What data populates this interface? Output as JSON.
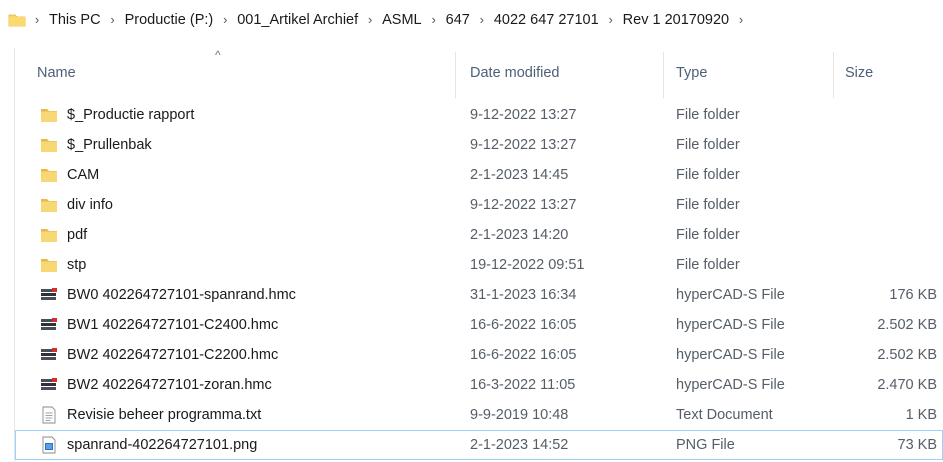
{
  "address_bar": {
    "crumbs": [
      "This PC",
      "Productie (P:)",
      "001_Artikel Archief",
      "ASML",
      "647",
      "4022 647 27101",
      "Rev 1 20170920"
    ]
  },
  "columns": {
    "name": "Name",
    "date": "Date modified",
    "type": "Type",
    "size": "Size"
  },
  "files": [
    {
      "name": "$_Productie rapport",
      "date": "9-12-2022 13:27",
      "type": "File folder",
      "size": "",
      "icon": "folder-icon"
    },
    {
      "name": "$_Prullenbak",
      "date": "9-12-2022 13:27",
      "type": "File folder",
      "size": "",
      "icon": "folder-icon"
    },
    {
      "name": "CAM",
      "date": "2-1-2023 14:45",
      "type": "File folder",
      "size": "",
      "icon": "folder-icon"
    },
    {
      "name": "div info",
      "date": "9-12-2022 13:27",
      "type": "File folder",
      "size": "",
      "icon": "folder-icon"
    },
    {
      "name": "pdf",
      "date": "2-1-2023 14:20",
      "type": "File folder",
      "size": "",
      "icon": "folder-icon"
    },
    {
      "name": "stp",
      "date": "19-12-2022 09:51",
      "type": "File folder",
      "size": "",
      "icon": "folder-icon"
    },
    {
      "name": "BW0 402264727101-spanrand.hmc",
      "date": "31-1-2023 16:34",
      "type": "hyperCAD-S File",
      "size": "176 KB",
      "icon": "hypercad-file-icon"
    },
    {
      "name": "BW1 402264727101-C2400.hmc",
      "date": "16-6-2022 16:05",
      "type": "hyperCAD-S File",
      "size": "2.502 KB",
      "icon": "hypercad-file-icon"
    },
    {
      "name": "BW2 402264727101-C2200.hmc",
      "date": "16-6-2022 16:05",
      "type": "hyperCAD-S File",
      "size": "2.502 KB",
      "icon": "hypercad-file-icon"
    },
    {
      "name": "BW2 402264727101-zoran.hmc",
      "date": "16-3-2022 11:05",
      "type": "hyperCAD-S File",
      "size": "2.470 KB",
      "icon": "hypercad-file-icon"
    },
    {
      "name": "Revisie beheer programma.txt",
      "date": "9-9-2019 10:48",
      "type": "Text Document",
      "size": "1 KB",
      "icon": "text-file-icon"
    },
    {
      "name": "spanrand-402264727101.png",
      "date": "2-1-2023 14:52",
      "type": "PNG File",
      "size": "73 KB",
      "icon": "png-file-icon",
      "selected": true
    }
  ],
  "colors": {
    "folder": "#f8d775",
    "folder_dark": "#e8b84a",
    "header_text": "#4c607a",
    "selection_border": "#99d1ff"
  }
}
